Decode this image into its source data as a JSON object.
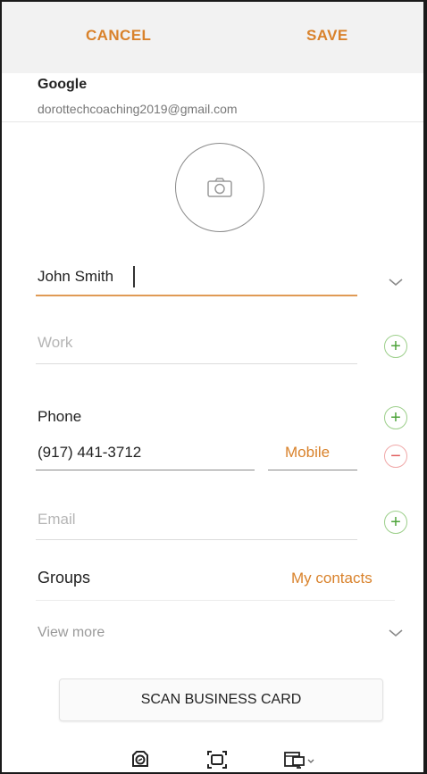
{
  "topbar": {
    "cancel_label": "CANCEL",
    "save_label": "SAVE"
  },
  "account": {
    "name": "Google",
    "email": "dorottechcoaching2019@gmail.com"
  },
  "photo": {
    "icon": "camera-icon"
  },
  "name_field": {
    "value": "John Smith",
    "expand_icon": "chevron-down-icon"
  },
  "work_field": {
    "placeholder": "Work",
    "add_icon": "plus-icon"
  },
  "phone": {
    "label": "Phone",
    "number": "(917) 441-3712",
    "type": "Mobile",
    "add_icon": "plus-icon",
    "remove_icon": "minus-icon"
  },
  "email_field": {
    "placeholder": "Email",
    "add_icon": "plus-icon"
  },
  "groups": {
    "label": "Groups",
    "value": "My contacts"
  },
  "view_more": {
    "label": "View more",
    "expand_icon": "chevron-down-icon"
  },
  "scan": {
    "label": "SCAN BUSINESS CARD"
  },
  "toolbar": {
    "icons": [
      "screenshot-icon",
      "crop-icon",
      "window-switch-icon"
    ]
  },
  "colors": {
    "accent": "#d9822b",
    "add": "#4da33a",
    "remove": "#e05a5a",
    "placeholder": "#b5b5b5"
  }
}
